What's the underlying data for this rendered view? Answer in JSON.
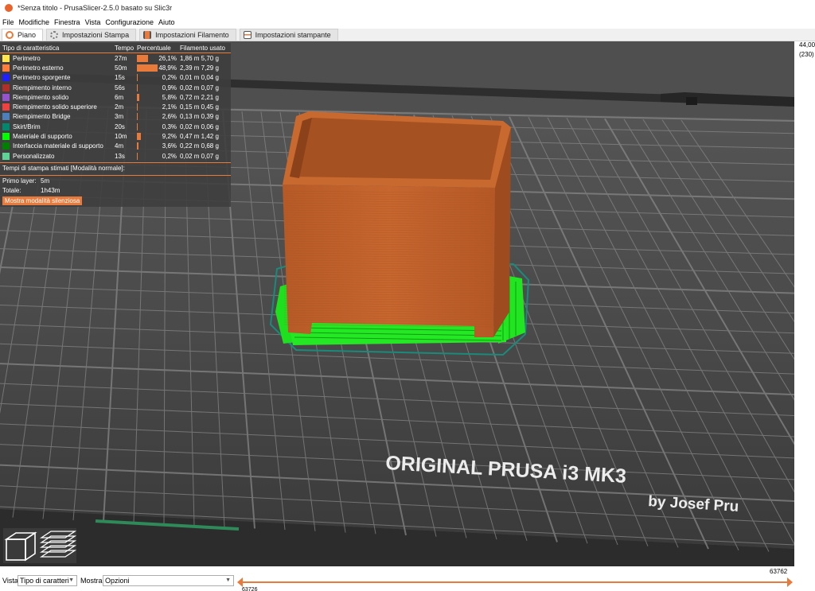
{
  "window": {
    "title": "*Senza titolo - PrusaSlicer-2.5.0 basato su Slic3r"
  },
  "menu": [
    "File",
    "Modifiche",
    "Finestra",
    "Vista",
    "Configurazione",
    "Aiuto"
  ],
  "tabs": [
    {
      "label": "Piano",
      "icon": "plater-icon",
      "active": true
    },
    {
      "label": "Impostazioni Stampa",
      "icon": "print-settings-gear-icon",
      "active": false
    },
    {
      "label": "Impostazioni Filamento",
      "icon": "filament-spool-icon",
      "active": false
    },
    {
      "label": "Impostazioni stampante",
      "icon": "printer-settings-icon",
      "active": false
    }
  ],
  "legend": {
    "headers": {
      "type": "Tipo di caratteristica",
      "time": "Tempo",
      "percent": "Percentuale",
      "filament": "Filamento usato"
    },
    "rows": [
      {
        "name": "Perimetro",
        "time": "27m",
        "percent": "26,1%",
        "pct": 26.1,
        "filament": "1,86 m  5,70 g",
        "color": "#ffe64d"
      },
      {
        "name": "Perimetro esterno",
        "time": "50m",
        "percent": "48,9%",
        "pct": 48.9,
        "filament": "2,39 m  7,29 g",
        "color": "#ff7d38"
      },
      {
        "name": "Perimetro sporgente",
        "time": "15s",
        "percent": "0,2%",
        "pct": 0.2,
        "filament": "0,01 m  0,04 g",
        "color": "#1f1fff"
      },
      {
        "name": "Riempimento interno",
        "time": "56s",
        "percent": "0,9%",
        "pct": 0.9,
        "filament": "0,02 m  0,07 g",
        "color": "#b03029"
      },
      {
        "name": "Riempimento solido",
        "time": "6m",
        "percent": "5,8%",
        "pct": 5.8,
        "filament": "0,72 m  2,21 g",
        "color": "#9654cc"
      },
      {
        "name": "Riempimento solido superiore",
        "time": "2m",
        "percent": "2,1%",
        "pct": 2.1,
        "filament": "0,15 m  0,45 g",
        "color": "#f04040"
      },
      {
        "name": "Riempimento Bridge",
        "time": "3m",
        "percent": "2,6%",
        "pct": 2.6,
        "filament": "0,13 m  0,39 g",
        "color": "#4d80ba"
      },
      {
        "name": "Skirt/Brim",
        "time": "20s",
        "percent": "0,3%",
        "pct": 0.3,
        "filament": "0,02 m  0,06 g",
        "color": "#00876e"
      },
      {
        "name": "Materiale di supporto",
        "time": "10m",
        "percent": "9,2%",
        "pct": 9.2,
        "filament": "0,47 m  1,42 g",
        "color": "#00ff00"
      },
      {
        "name": "Interfaccia materiale di supporto",
        "time": "4m",
        "percent": "3,6%",
        "pct": 3.6,
        "filament": "0,22 m  0,68 g",
        "color": "#008000"
      },
      {
        "name": "Personalizzato",
        "time": "13s",
        "percent": "0,2%",
        "pct": 0.2,
        "filament": "0,02 m  0,07 g",
        "color": "#5ed194"
      }
    ],
    "estimated_label": "Tempi di stampa stimati [Modalità normale]:",
    "first_layer_label": "Primo layer:",
    "first_layer_value": "5m",
    "total_label": "Totale:",
    "total_value": "1h43m",
    "silent_button": "Mostra modalità silenziosa"
  },
  "bed": {
    "text_line1": "ORIGINAL PRUSA i3  MK3",
    "text_line2": "by Josef Pru"
  },
  "right_panel": {
    "height_value": "44,00",
    "layer_value": "(230)"
  },
  "bottom": {
    "view_label": "Vista",
    "view_select": "Tipo di caratteri",
    "show_label": "Mostra",
    "show_select": "Opzioni",
    "slider_max": "63762",
    "slider_min": "63726"
  },
  "colors": {
    "accent": "#e87b3c",
    "object": "#c1622b",
    "support": "#1fe01f",
    "bed": "#3f3f3f"
  }
}
